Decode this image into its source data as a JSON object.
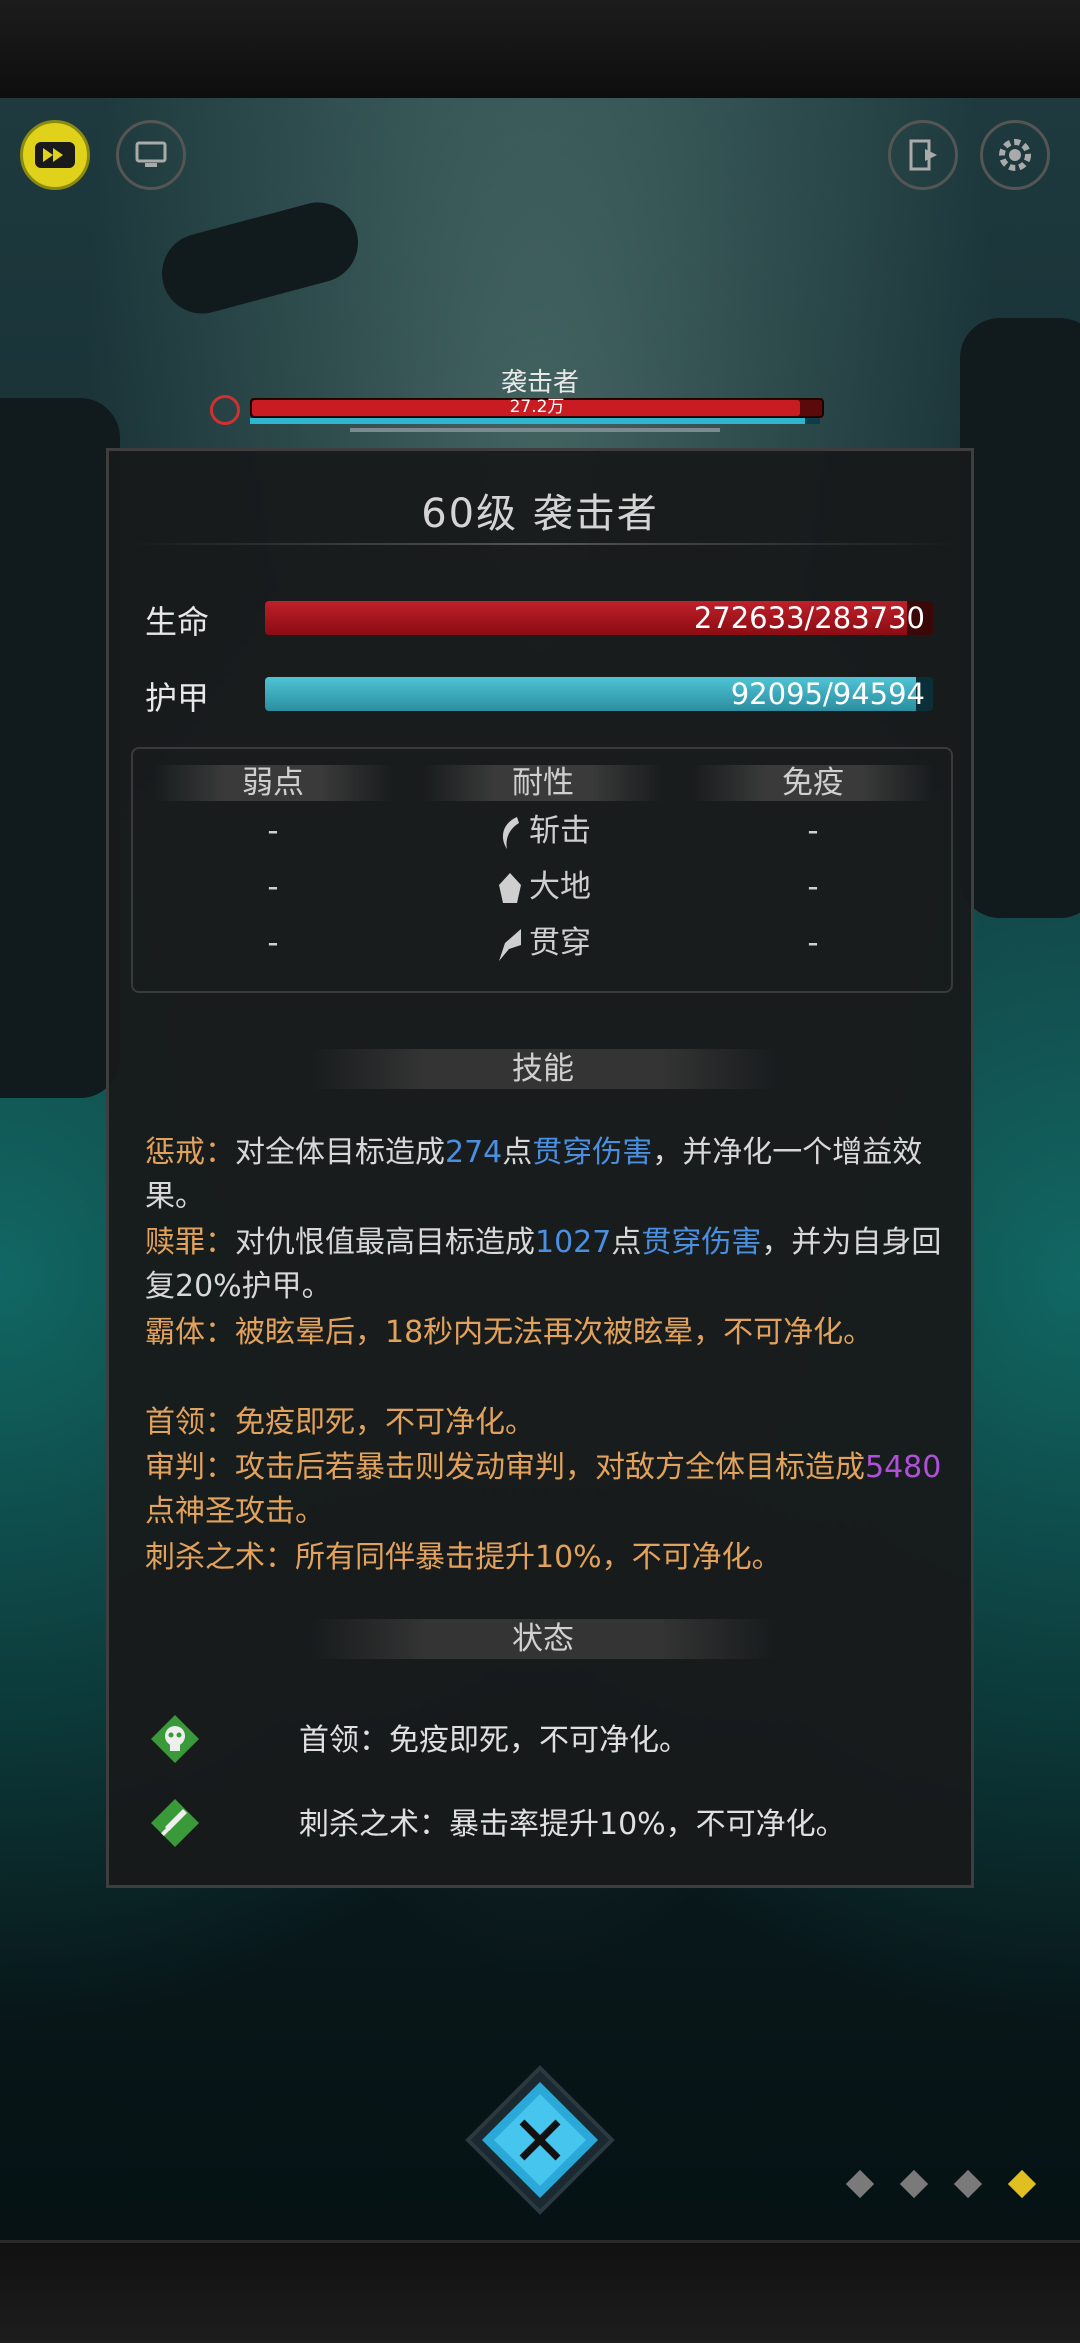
{
  "boss_header": {
    "name": "袭击者",
    "hp_text": "27.2万",
    "hp_fraction": 0.961,
    "armor_fraction": 0.974
  },
  "panel": {
    "title": "60级  袭击者",
    "hp_label": "生命",
    "hp_value": "272633/283730",
    "hp_fraction": 0.961,
    "armor_label": "护甲",
    "armor_value": "92095/94594",
    "armor_fraction": 0.974,
    "resist_headers": [
      "弱点",
      "耐性",
      "免疫"
    ],
    "weak": [
      "-",
      "-",
      "-"
    ],
    "resist": [
      "斩击",
      "大地",
      "贯穿"
    ],
    "immune": [
      "-",
      "-",
      "-"
    ],
    "skills_header": "技能",
    "skills": {
      "s1_name": "惩戒：",
      "s1_a": "对全体目标造成",
      "s1_num": "274",
      "s1_b": "点",
      "s1_dmg": "贯穿伤害",
      "s1_c": "，并净化一个增益效果。",
      "s2_name": "赎罪：",
      "s2_a": "对仇恨值最高目标造成",
      "s2_num": "1027",
      "s2_b": "点",
      "s2_dmg": "贯穿伤害",
      "s2_c": "，并为自身回复20%护甲。",
      "s3": "霸体：被眩晕后，18秒内无法再次被眩晕，不可净化。",
      "s4": "首领：免疫即死，不可净化。",
      "s5_a": "审判：攻击后若暴击则发动审判，对敌方全体目标造成",
      "s5_num": "5480",
      "s5_b": "点神圣攻击。",
      "s6": "刺杀之术：所有同伴暴击提升10%，不可净化。"
    },
    "status_header": "状态",
    "statuses": [
      {
        "icon": "skull-icon",
        "text": "首领：免疫即死，不可净化。"
      },
      {
        "icon": "sword-icon",
        "text": "刺杀之术：暴击率提升10%，不可净化。"
      }
    ]
  },
  "colors": {
    "hp": "#c0202a",
    "armor": "#4fc4d6",
    "skill_orange": "#e2a25c",
    "damage_blue": "#4b8fe0",
    "holy_purple": "#b04fd8",
    "status_green": "#3a9a3a"
  },
  "top_buttons": [
    "fast-forward-icon",
    "auto-battle-icon",
    "exit-icon",
    "settings-icon"
  ],
  "page_dots": {
    "count": 4,
    "active": 3
  }
}
